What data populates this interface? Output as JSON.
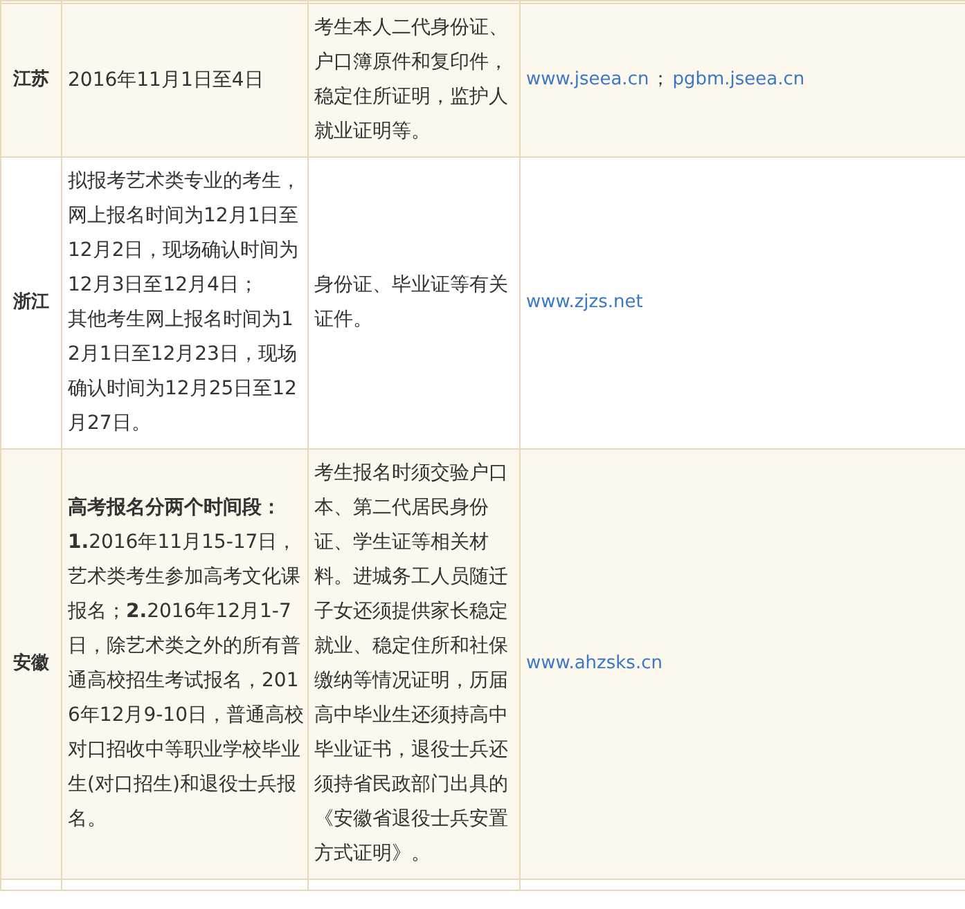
{
  "rows": [
    {
      "province": "江苏",
      "schedule": [
        "2016年11月1日至4日"
      ],
      "documents": "考生本人二代身份证、户口簿原件和复印件，稳定住所证明，监护人就业证明等。",
      "links": [
        "www.jseea.cn",
        "pgbm.jseea.cn"
      ],
      "separator": "；",
      "shaded": true
    },
    {
      "province": "浙江",
      "schedule": [
        "拟报考艺术类专业的考生，网上报名时间为12月1日至12月2日，现场确认时间为12月3日至12月4日；",
        "其他考生网上报名时间为12月1日至12月23日，现场确认时间为12月25日至12月27日。"
      ],
      "documents": "身份证、毕业证等有关证件。",
      "links": [
        "www.zjzs.net"
      ],
      "shaded": false
    },
    {
      "province": "安徽",
      "schedule": [
        "**高考报名分两个时间段：**",
        "**1.**2016年11月15-17日，艺术类考生参加高考文化课报名；**2.**2016年12月1-7日，除艺术类之外的所有普通高校招生考试报名，2016年12月9-10日，普通高校对口招收中等职业学校毕业生(对口招生)和退役士兵报名。"
      ],
      "documents": "考生报名时须交验户口本、第二代居民身份证、学生证等相关材料。进城务工人员随迁子女还须提供家长稳定就业、稳定住所和社保缴纳等情况证明，历届高中毕业生还须持高中毕业证书，退役士兵还须持省民政部门出具的《安徽省退役士兵安置方式证明》。",
      "links": [
        "www.ahzsks.cn"
      ],
      "shaded": true
    }
  ]
}
